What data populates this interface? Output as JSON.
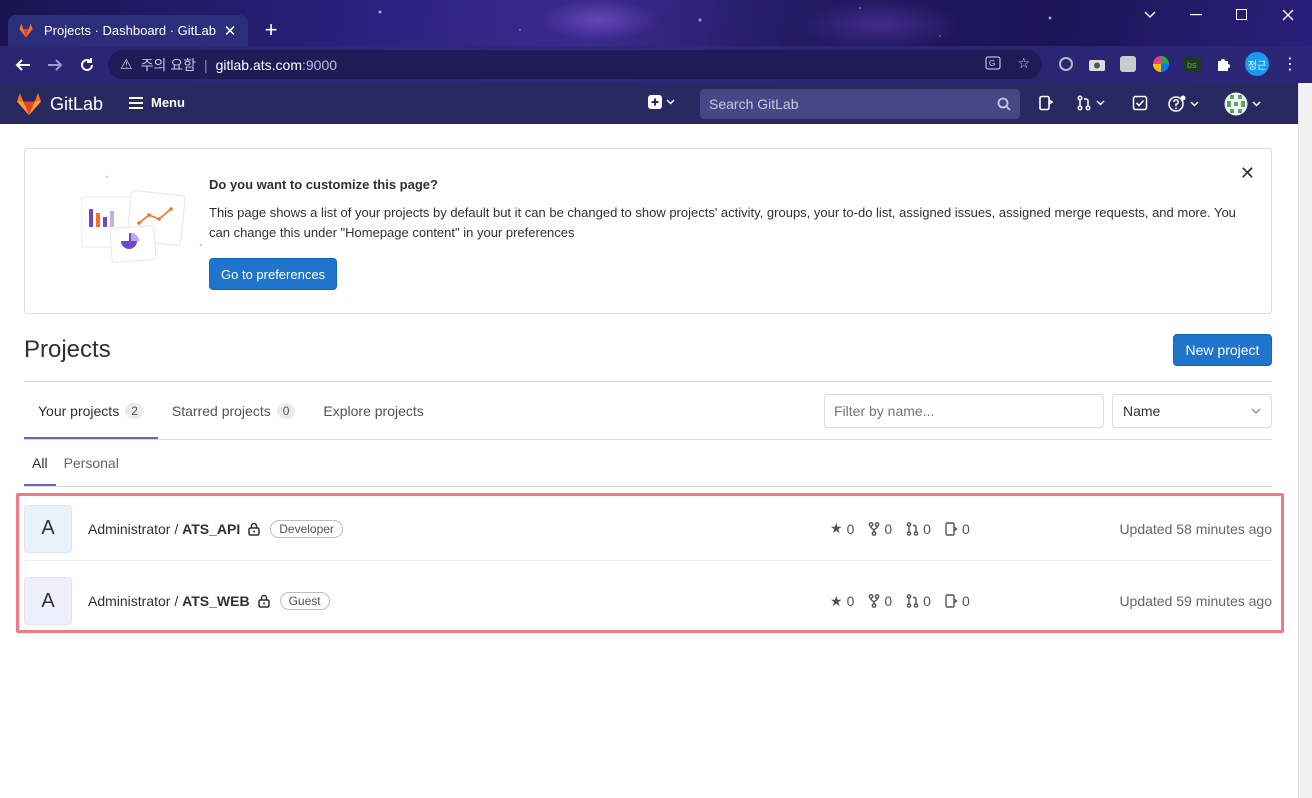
{
  "browser": {
    "tab_title": "Projects · Dashboard · GitLab",
    "security_text": "주의 요함",
    "url_host": "gitlab.ats.com",
    "url_port": ":9000",
    "profile_label": "정근"
  },
  "gitlab": {
    "brand": "GitLab",
    "menu_label": "Menu",
    "search_placeholder": "Search GitLab"
  },
  "banner": {
    "heading": "Do you want to customize this page?",
    "body": "This page shows a list of your projects by default but it can be changed to show projects' activity, groups, your to-do list, assigned issues, assigned merge requests, and more. You can change this under \"Homepage content\" in your preferences",
    "button": "Go to preferences",
    "dismiss": "✕"
  },
  "page": {
    "title": "Projects",
    "new_project": "New project"
  },
  "tabs": [
    {
      "label": "Your projects",
      "count": "2"
    },
    {
      "label": "Starred projects",
      "count": "0"
    },
    {
      "label": "Explore projects"
    }
  ],
  "filter": {
    "placeholder": "Filter by name...",
    "sort": "Name"
  },
  "subtabs": [
    {
      "label": "All"
    },
    {
      "label": "Personal"
    }
  ],
  "projects": [
    {
      "avatar": "A",
      "namespace": "Administrator / ",
      "name": "ATS_API",
      "role": "Developer",
      "stars": "0",
      "forks": "0",
      "mrs": "0",
      "issues": "0",
      "updated": "Updated 58 minutes ago",
      "avatar_bg": "#e9f3fc"
    },
    {
      "avatar": "A",
      "namespace": "Administrator / ",
      "name": "ATS_WEB",
      "role": "Guest",
      "stars": "0",
      "forks": "0",
      "mrs": "0",
      "issues": "0",
      "updated": "Updated 59 minutes ago",
      "avatar_bg": "#f0f0fc"
    }
  ],
  "colors": {
    "primary": "#1f75cb",
    "header": "#292961",
    "highlight": "#ef7b86"
  }
}
